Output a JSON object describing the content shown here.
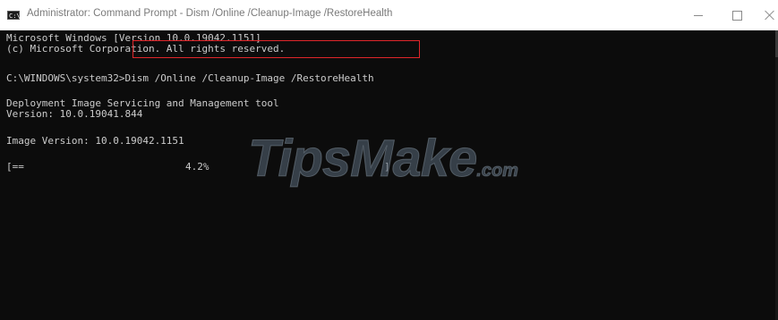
{
  "window": {
    "title": "Administrator: Command Prompt - Dism  /Online /Cleanup-Image /RestoreHealth",
    "app_icon_text": "C:\\",
    "buttons": [
      "minimize",
      "maximize",
      "close"
    ]
  },
  "console": {
    "lines": [
      "Microsoft Windows [Version 10.0.19042.1151]",
      "(c) Microsoft Corporation. All rights reserved.",
      "",
      "C:\\WINDOWS\\system32>Dism /Online /Cleanup-Image /RestoreHealth",
      "",
      "Deployment Image Servicing and Management tool",
      "Version: 10.0.19041.844",
      "",
      "Image Version: 10.0.19042.1151",
      "",
      "[==                         4.2%"
    ],
    "prompt": "C:\\WINDOWS\\system32>",
    "command": "Dism /Online /Cleanup-Image /RestoreHealth",
    "progress_bar": "[==",
    "progress_percent": "4.2%",
    "progress_value": 0.042,
    "progress_close": "]"
  },
  "watermark": {
    "text": "TipsMake",
    "suffix": ".com"
  },
  "colors": {
    "console_bg": "#0c0c0c",
    "console_text": "#cccccc",
    "highlight": "#e0262a",
    "titlebar_bg": "#ffffff"
  }
}
